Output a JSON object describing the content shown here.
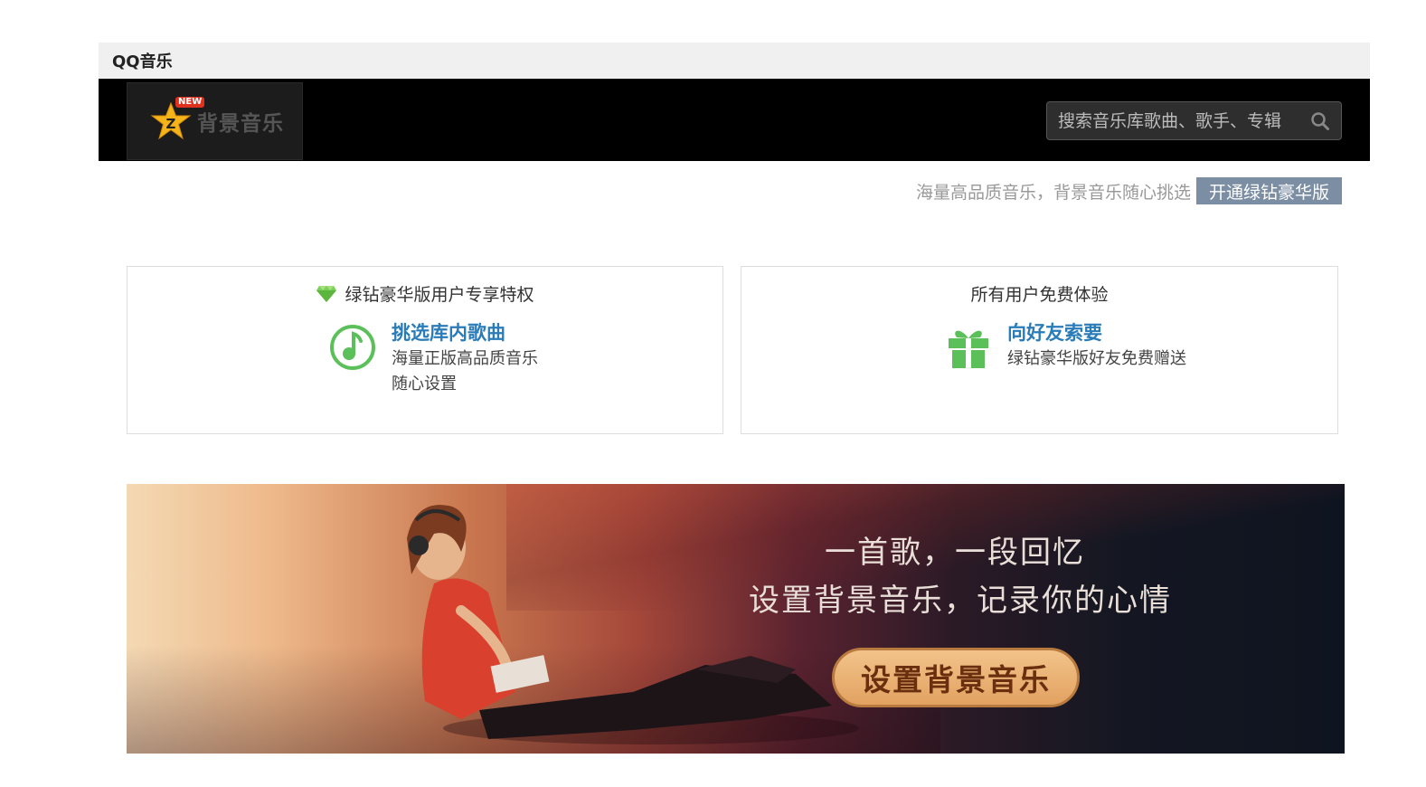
{
  "window": {
    "title": "QQ音乐"
  },
  "header": {
    "logo_badge": "NEW",
    "logo_text": "背景音乐",
    "search_placeholder": "搜索音乐库歌曲、歌手、专辑"
  },
  "promo": {
    "text": "海量高品质音乐，背景音乐随心挑选",
    "button": "开通绿钻豪华版"
  },
  "cards": {
    "left": {
      "title": "绿钻豪华版用户专享特权",
      "heading": "挑选库内歌曲",
      "desc_line1": "海量正版高品质音乐",
      "desc_line2": "随心设置"
    },
    "right": {
      "title": "所有用户免费体验",
      "heading": "向好友索要",
      "desc_line1": "绿钻豪华版好友免费赠送"
    }
  },
  "banner": {
    "line1": "一首歌，一段回忆",
    "line2": "设置背景音乐，记录你的心情",
    "button": "设置背景音乐"
  },
  "colors": {
    "accent_blue": "#2a7cb8",
    "green": "#5cc05a",
    "promo_button": "#7c8ea3"
  }
}
